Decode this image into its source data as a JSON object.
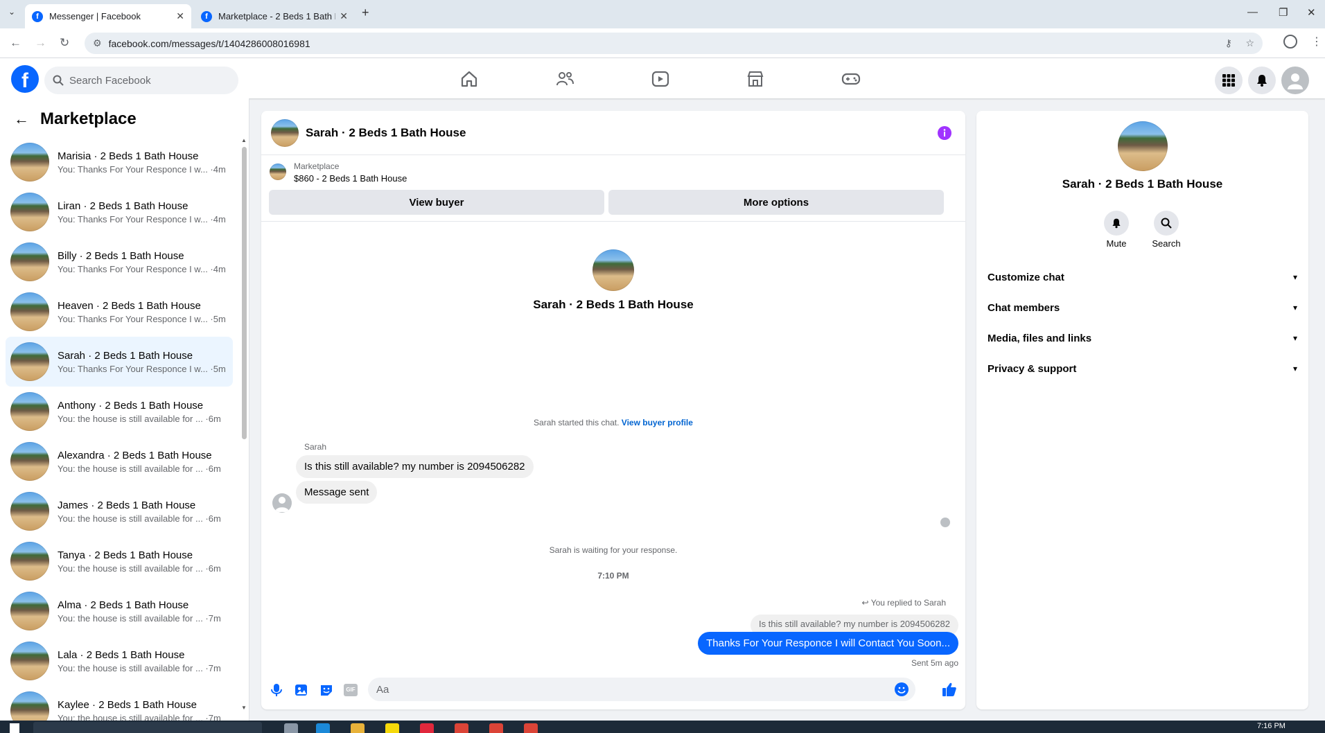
{
  "browser": {
    "tabs": [
      {
        "label": "Messenger | Facebook"
      },
      {
        "label": "Marketplace - 2 Beds 1 Bath Ho"
      }
    ],
    "url": "facebook.com/messages/t/1404286008016981"
  },
  "fb": {
    "search_placeholder": "Search Facebook"
  },
  "sidebar": {
    "title": "Marketplace",
    "conversations": [
      {
        "name": "Marisia · 2 Beds 1 Bath House",
        "snippet": "You: Thanks For Your Responce I w... ·4m"
      },
      {
        "name": "Liran · 2 Beds 1 Bath House",
        "snippet": "You: Thanks For Your Responce I w... ·4m"
      },
      {
        "name": "Billy · 2 Beds 1 Bath House",
        "snippet": "You: Thanks For Your Responce I w... ·4m"
      },
      {
        "name": "Heaven · 2 Beds 1 Bath House",
        "snippet": "You: Thanks For Your Responce I w... ·5m"
      },
      {
        "name": "Sarah · 2 Beds 1 Bath House",
        "snippet": "You: Thanks For Your Responce I w... ·5m"
      },
      {
        "name": "Anthony · 2 Beds 1 Bath House",
        "snippet": "You: the house is still available for ... ·6m"
      },
      {
        "name": "Alexandra · 2 Beds 1 Bath House",
        "snippet": "You: the house is still available for ... ·6m"
      },
      {
        "name": "James · 2 Beds 1 Bath House",
        "snippet": "You: the house is still available for ... ·6m"
      },
      {
        "name": "Tanya · 2 Beds 1 Bath House",
        "snippet": "You: the house is still available for ... ·6m"
      },
      {
        "name": "Alma · 2 Beds 1 Bath House",
        "snippet": "You: the house is still available for ... ·7m"
      },
      {
        "name": "Lala · 2 Beds 1 Bath House",
        "snippet": "You: the house is still available for ... ·7m"
      },
      {
        "name": "Kaylee · 2 Beds 1 Bath House",
        "snippet": "You: the house is still available for ... ·7m"
      }
    ]
  },
  "chat": {
    "title": "Sarah · 2 Beds 1 Bath House",
    "marketplace_label": "Marketplace",
    "listing": "$860 - 2 Beds 1 Bath House",
    "view_buyer": "View buyer",
    "more_options": "More options",
    "intro_name": "Sarah · 2 Beds 1 Bath House",
    "started": "Sarah started this chat.",
    "view_buyer_profile": "View buyer profile",
    "sender": "Sarah",
    "msg1": "Is this still available? my number is 2094506282",
    "msg2": "Message sent",
    "waiting": "Sarah is waiting for your response.",
    "time": "7:10 PM",
    "replied": "You replied to Sarah",
    "quote": "Is this still available? my number is 2094506282",
    "my_msg": "Thanks For Your Responce I will Contact You Soon...",
    "sent": "Sent 5m ago",
    "input_placeholder": "Aa",
    "accent": "#0866ff"
  },
  "info": {
    "name": "Sarah · 2 Beds 1 Bath House",
    "mute": "Mute",
    "search": "Search",
    "rows": [
      "Customize chat",
      "Chat members",
      "Media, files and links",
      "Privacy & support"
    ]
  },
  "taskbar": {
    "time": "7:16 PM"
  }
}
